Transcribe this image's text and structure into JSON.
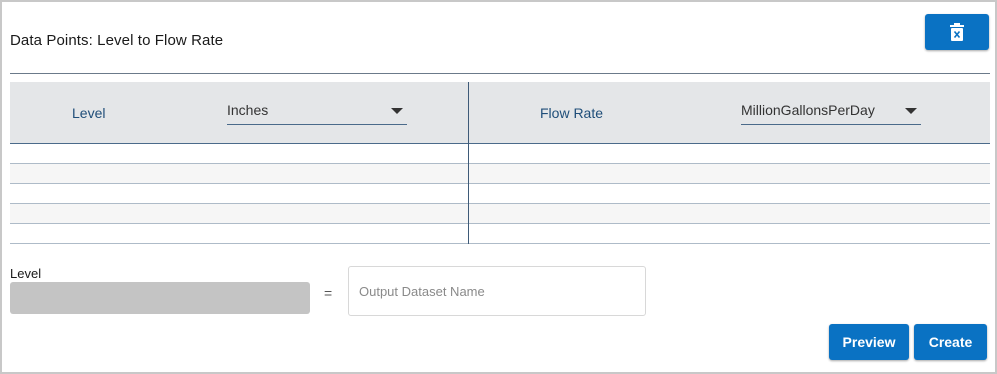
{
  "header": {
    "title": "Data Points: Level to Flow Rate",
    "delete_icon": "trash-icon"
  },
  "table": {
    "left": {
      "label": "Level",
      "unit": "Inches"
    },
    "right": {
      "label": "Flow Rate",
      "unit": "MillionGallonsPerDay"
    },
    "rows": [
      {
        "level": "",
        "flow_rate": ""
      },
      {
        "level": "",
        "flow_rate": ""
      },
      {
        "level": "",
        "flow_rate": ""
      },
      {
        "level": "",
        "flow_rate": ""
      },
      {
        "level": "",
        "flow_rate": ""
      }
    ]
  },
  "output": {
    "level_label": "Level",
    "level_value": "",
    "equals": "=",
    "dataset_name_value": "",
    "dataset_name_placeholder": "Output Dataset Name"
  },
  "actions": {
    "preview_label": "Preview",
    "create_label": "Create"
  },
  "colors": {
    "accent": "#0a72c3",
    "header_bg": "#e4e6e8",
    "header_text": "#1f4e79",
    "disabled_field": "#c4c4c4"
  }
}
